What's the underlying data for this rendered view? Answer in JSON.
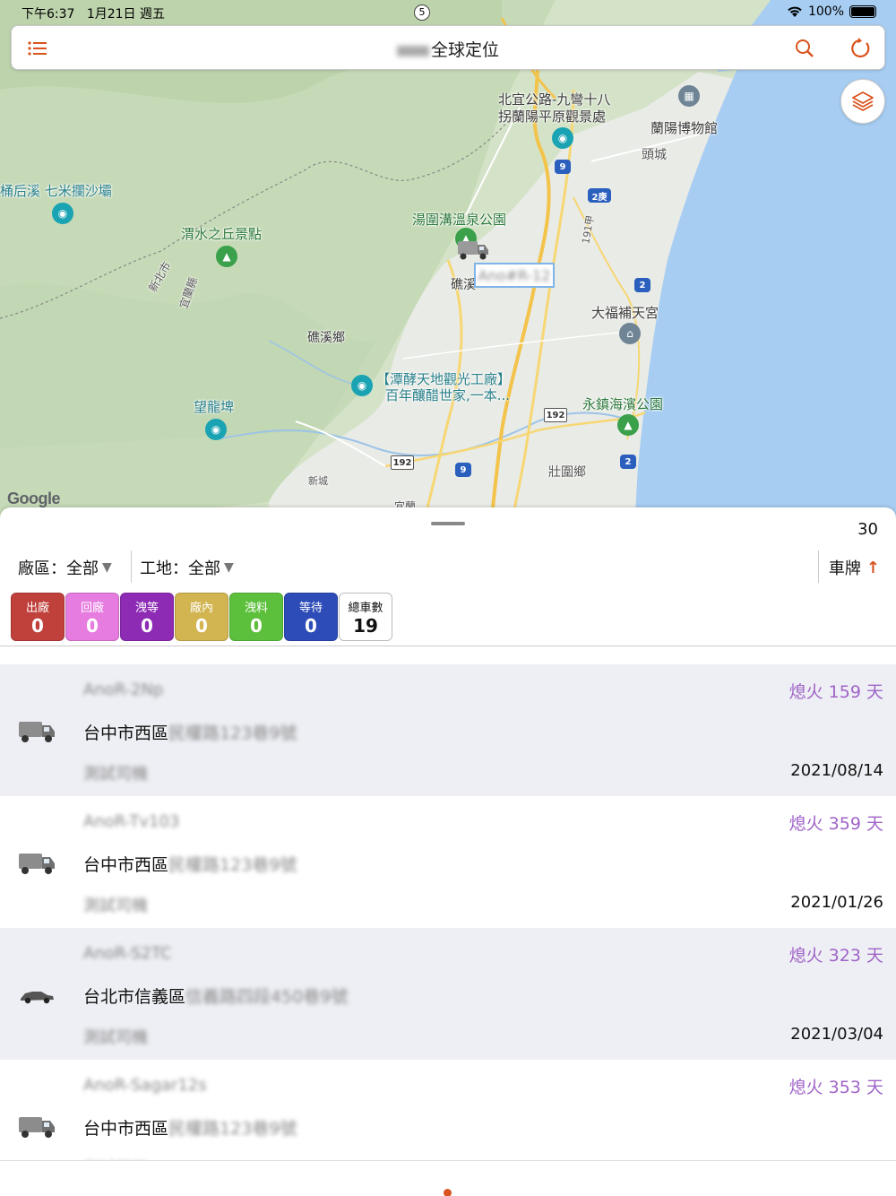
{
  "status_bar": {
    "time": "下午6:37",
    "date": "1月21日 週五",
    "center_badge": "5",
    "battery": "100%"
  },
  "topbar": {
    "title": "全球定位"
  },
  "map": {
    "labels": {
      "beiyi": "北宜公路-九彎十八",
      "beiyi2": "拐蘭陽平原觀景處",
      "lanyang": "蘭陽博物館",
      "toucheng": "頭城",
      "tongou": "湯圍溝溫泉公園",
      "tonghou": "桶后溪 七米攔沙壩",
      "weishui": "渭水之丘景點",
      "xinbei": "新北市",
      "yilan": "宜蘭縣",
      "jiaoxi_short": "礁溪",
      "jiaoxi_town": "礁溪鄉",
      "dafu": "大福補天宮",
      "tanfa1": "【潭酵天地觀光工廠】",
      "tanfa2": "百年釀醋世家,一本...",
      "wanglong": "望龍埤",
      "yongzhen": "永鎮海濱公園",
      "zhuangwei": "壯圍鄉",
      "xincheng": "新城",
      "yilan_city": "宜蘭",
      "google": "Google"
    },
    "shields": {
      "r9a": "9",
      "r9b": "9",
      "r2geng": "2庚",
      "r2a": "2",
      "r2b": "2",
      "r191": "191甲",
      "r192a": "192",
      "r192b": "192"
    },
    "plate_callout": "Ano#R-12"
  },
  "sheet": {
    "count": "30",
    "filter_area_label": "廠區：全部",
    "filter_site_label": "工地：全部",
    "sort_label": "車牌",
    "chips": [
      {
        "label": "出廠",
        "value": "0",
        "color": "#c0403c"
      },
      {
        "label": "回廠",
        "value": "0",
        "color": "#e67ce0"
      },
      {
        "label": "洩等",
        "value": "0",
        "color": "#8d2bb5"
      },
      {
        "label": "廠內",
        "value": "0",
        "color": "#d2b450"
      },
      {
        "label": "洩料",
        "value": "0",
        "color": "#5dc03c"
      },
      {
        "label": "等待",
        "value": "0",
        "color": "#2d4cb8"
      },
      {
        "label": "總車數",
        "value": "19",
        "color": "#ffffff"
      }
    ],
    "rows": [
      {
        "plate": "AnoR-2Np",
        "address": "台中市西區",
        "address_blur": "民權路123巷9號",
        "driver": "測試司機",
        "status": "熄火 159 天",
        "date": "2021/08/14",
        "vehicle": "truck"
      },
      {
        "plate": "AnoR-Tv103",
        "address": "台中市西區",
        "address_blur": "民權路123巷9號",
        "driver": "測試司機",
        "status": "熄火 359 天",
        "date": "2021/01/26",
        "vehicle": "truck"
      },
      {
        "plate": "AnoR-S2TC",
        "address": "台北市信義區",
        "address_blur": "信義路四段450巷9號",
        "driver": "測試司機",
        "status": "熄火 323 天",
        "date": "2021/03/04",
        "vehicle": "car"
      },
      {
        "plate": "AnoR-Sagar12s",
        "address": "台中市西區",
        "address_blur": "民權路123巷9號",
        "driver": "測試司機",
        "status": "熄火 353 天",
        "date": "",
        "vehicle": "truck"
      }
    ]
  }
}
